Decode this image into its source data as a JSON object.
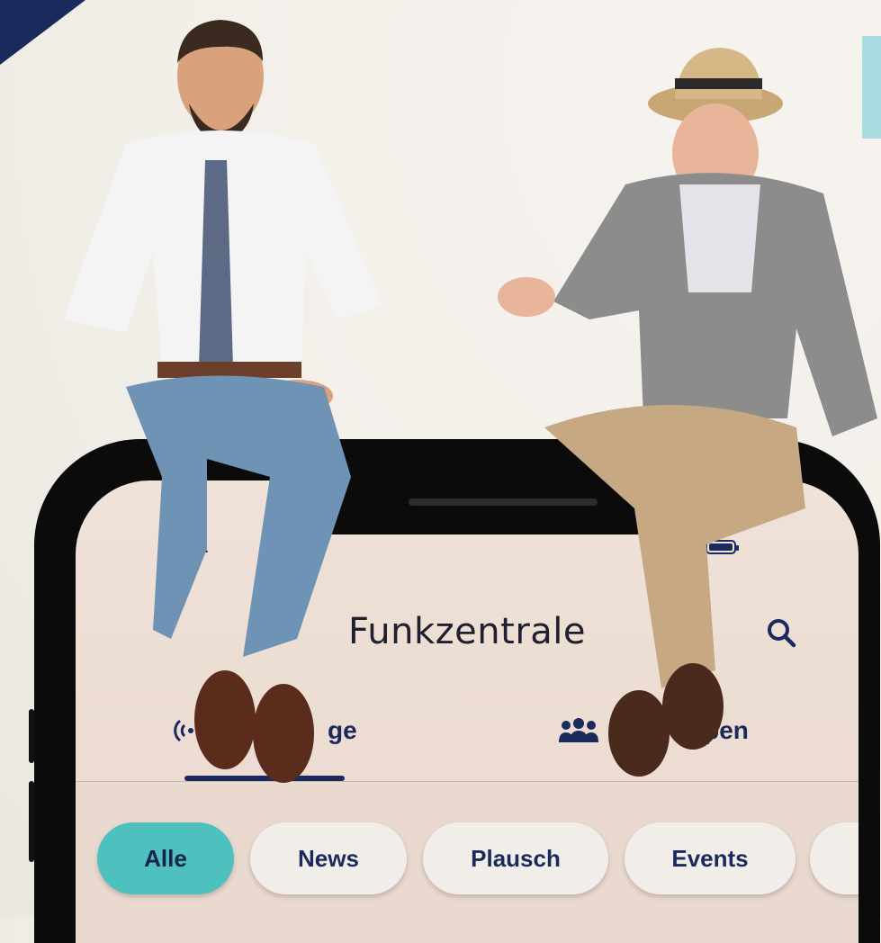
{
  "app": {
    "title": "Funkzentrale",
    "status_time": "1"
  },
  "tabs": [
    {
      "label": "ge",
      "icon": "radio-waves-icon",
      "active": true
    },
    {
      "label": "ppen",
      "icon": "group-icon",
      "active": false
    }
  ],
  "chips": [
    {
      "label": "Alle",
      "active": true
    },
    {
      "label": "News",
      "active": false
    },
    {
      "label": "Plausch",
      "active": false
    },
    {
      "label": "Events",
      "active": false
    }
  ],
  "colors": {
    "brand_navy": "#1b2a5c",
    "accent_teal": "#4ec1bf",
    "screen_bg": "#ecdcd2"
  }
}
